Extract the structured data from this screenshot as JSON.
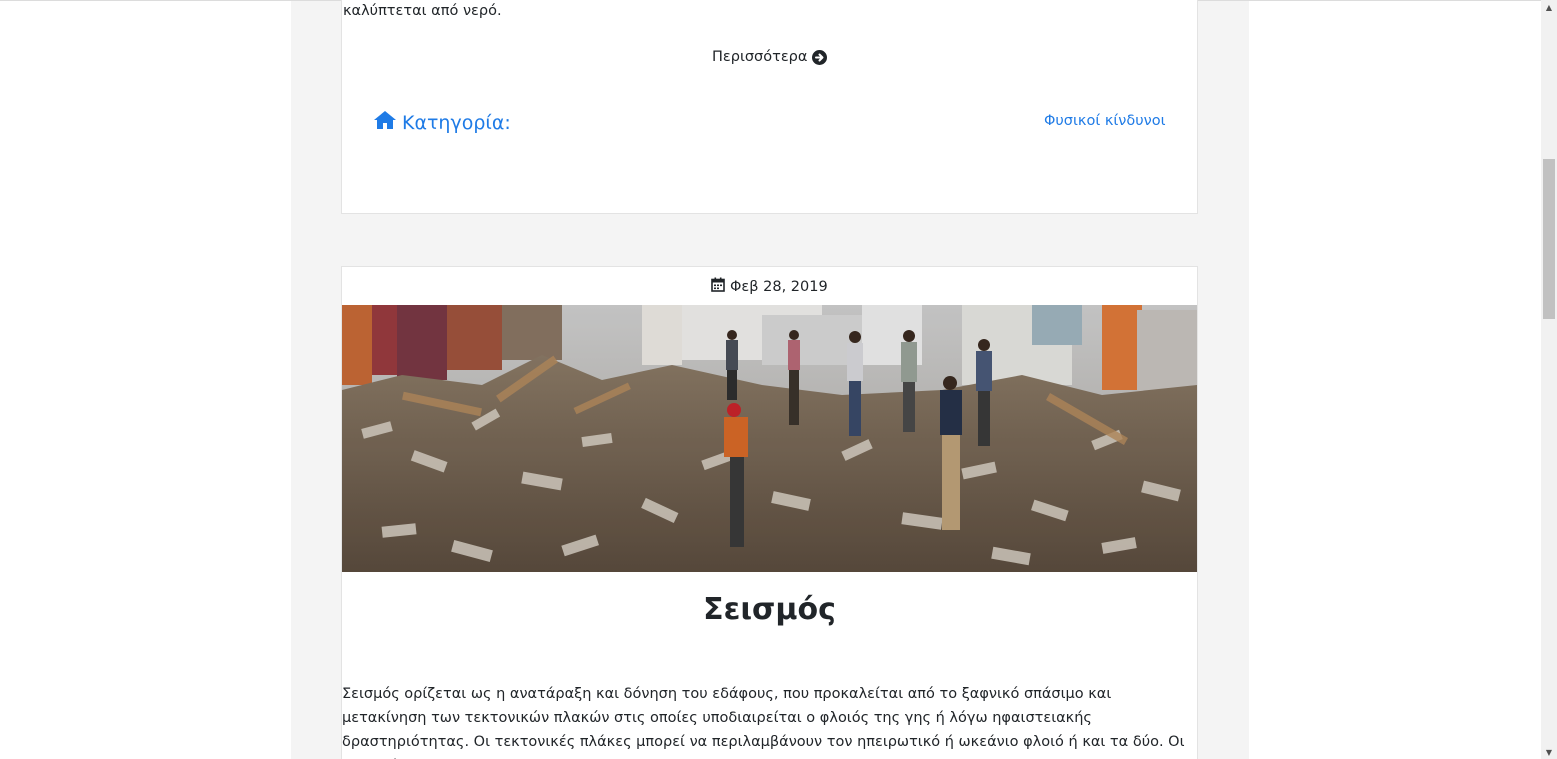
{
  "previous_post": {
    "trailing_text": "καλύπτεται από νερό.",
    "more_link_label": "Περισσότερα",
    "more_icon": "arrow-circle-right-icon",
    "category_label": "Κατηγορία:",
    "category_icon": "home-icon",
    "category_value": "Φυσικοί κίνδυνοι"
  },
  "post": {
    "date": "Φεβ 28, 2019",
    "date_icon": "calendar-icon",
    "image_alt": "earthquake rubble photo",
    "title": "Σεισμός",
    "body": "Σεισμός ορίζεται ως η ανατάραξη και δόνηση του εδάφους, που προκαλείται από το ξαφνικό σπάσιμο και μετακίνηση των τεκτονικών πλακών στις οποίες υποδιαιρείται ο φλοιός της γης ή λόγω ηφαιστειακής δραστηριότητας. Οι τεκτονικές πλάκες μπορεί να περιλαμβάνουν τον ηπειρωτικό ή ωκεάνιο φλοιό ή και τα δύο. Οι σεισμοί"
  },
  "colors": {
    "link": "#1f7be6",
    "text": "#212529",
    "column_bg": "#f4f4f4"
  }
}
